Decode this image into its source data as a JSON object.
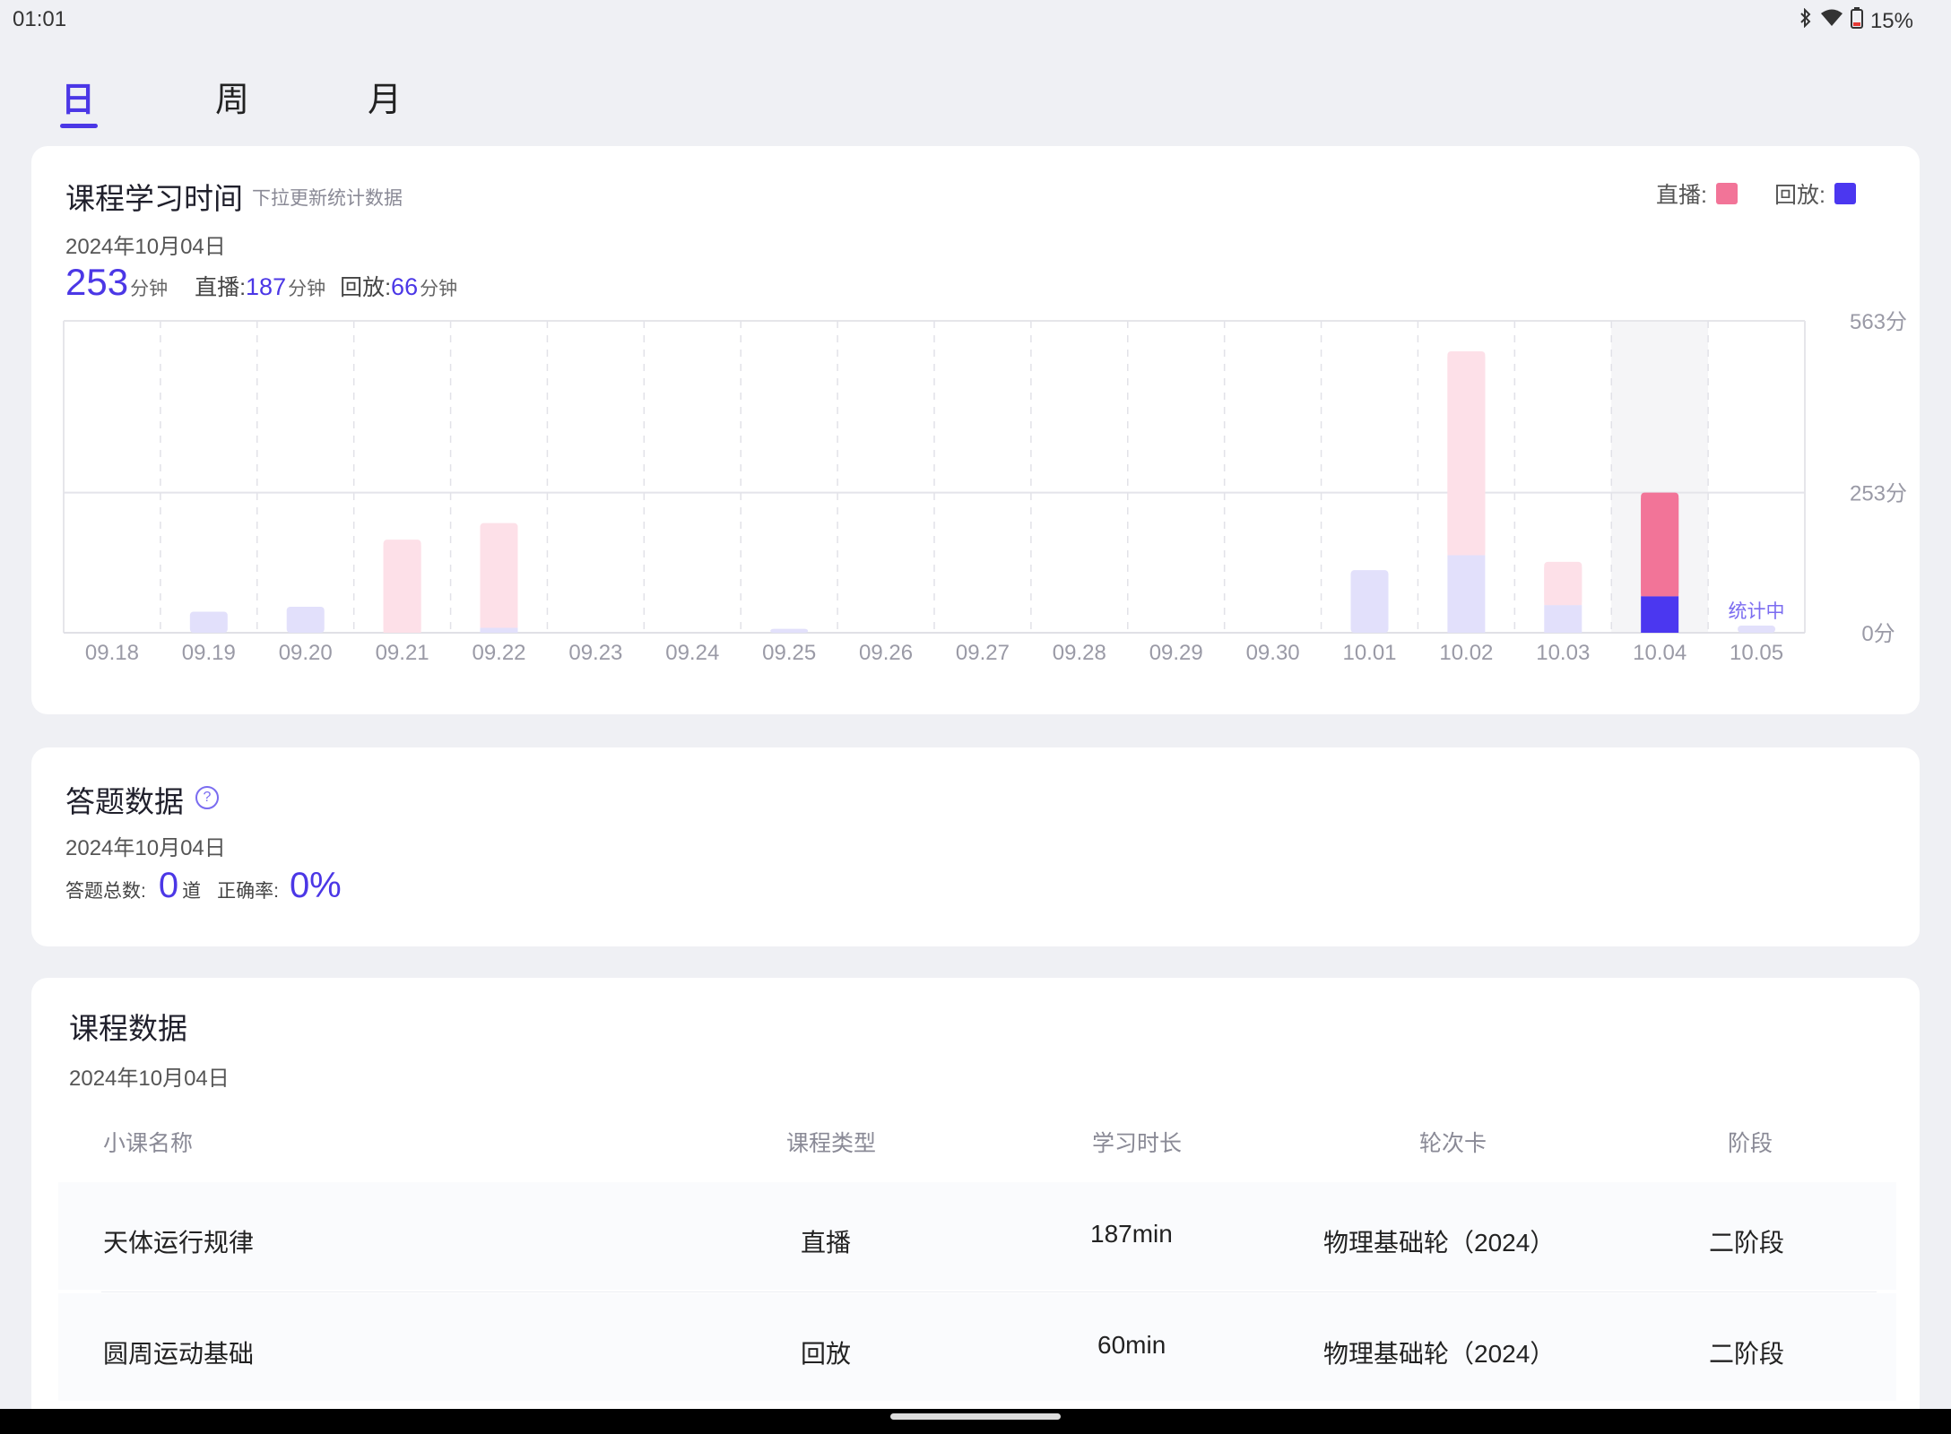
{
  "status_bar": {
    "time": "01:01",
    "battery": "15%",
    "bluetooth_icon": "bluetooth-icon",
    "wifi_icon": "wifi-icon",
    "battery_icon": "battery-icon"
  },
  "tabs": [
    {
      "label": "日",
      "active": true
    },
    {
      "label": "周",
      "active": false
    },
    {
      "label": "月",
      "active": false
    }
  ],
  "study_time": {
    "title": "课程学习时间",
    "subtitle": "下拉更新统计数据",
    "legend": {
      "live_label": "直播:",
      "replay_label": "回放:"
    },
    "date": "2024年10月04日",
    "total": "253",
    "unit": "分钟",
    "live_label": "直播:",
    "live_value": "187",
    "replay_label": "回放:",
    "replay_value": "66",
    "counting_label": "统计中"
  },
  "chart_data": {
    "type": "bar",
    "stacked": true,
    "categories": [
      "09.18",
      "09.19",
      "09.20",
      "09.21",
      "09.22",
      "09.23",
      "09.24",
      "09.25",
      "09.26",
      "09.27",
      "09.28",
      "09.29",
      "09.30",
      "10.01",
      "10.02",
      "10.03",
      "10.04",
      "10.05"
    ],
    "series": [
      {
        "name": "直播",
        "color": "#f27498",
        "values": [
          0,
          0,
          0,
          168,
          189,
          0,
          0,
          0,
          0,
          0,
          0,
          0,
          0,
          0,
          368,
          78,
          187,
          0
        ]
      },
      {
        "name": "回放",
        "color": "#4b37f0",
        "values": [
          0,
          38,
          47,
          0,
          9,
          0,
          0,
          7,
          0,
          0,
          0,
          0,
          0,
          113,
          140,
          50,
          66,
          13
        ]
      }
    ],
    "y_ticks": [
      "0分",
      "253分",
      "563分"
    ],
    "y_tick_values": [
      0,
      253,
      563
    ],
    "ylim": [
      0,
      563
    ],
    "selected_category": "10.04",
    "grid": true,
    "legend_position": "top-right"
  },
  "answers": {
    "title": "答题数据",
    "help_icon": "question-circle-icon",
    "date": "2024年10月04日",
    "total_label": "答题总数:",
    "total_value": "0",
    "total_unit": "道",
    "accuracy_label": "正确率:",
    "accuracy_value": "0%"
  },
  "courses": {
    "title": "课程数据",
    "date": "2024年10月04日",
    "columns": [
      "小课名称",
      "课程类型",
      "学习时长",
      "轮次卡",
      "阶段"
    ],
    "rows": [
      [
        "天体运行规律",
        "直播",
        "187min",
        "物理基础轮（2024）",
        "二阶段"
      ],
      [
        "圆周运动基础",
        "回放",
        "60min",
        "物理基础轮（2024）",
        "二阶段"
      ]
    ]
  },
  "colors": {
    "accent": "#4b37e6",
    "live": "#f27498",
    "live_faded": "#fde0e8",
    "replay": "#4b37f0",
    "replay_faded": "#e2e0fb"
  }
}
